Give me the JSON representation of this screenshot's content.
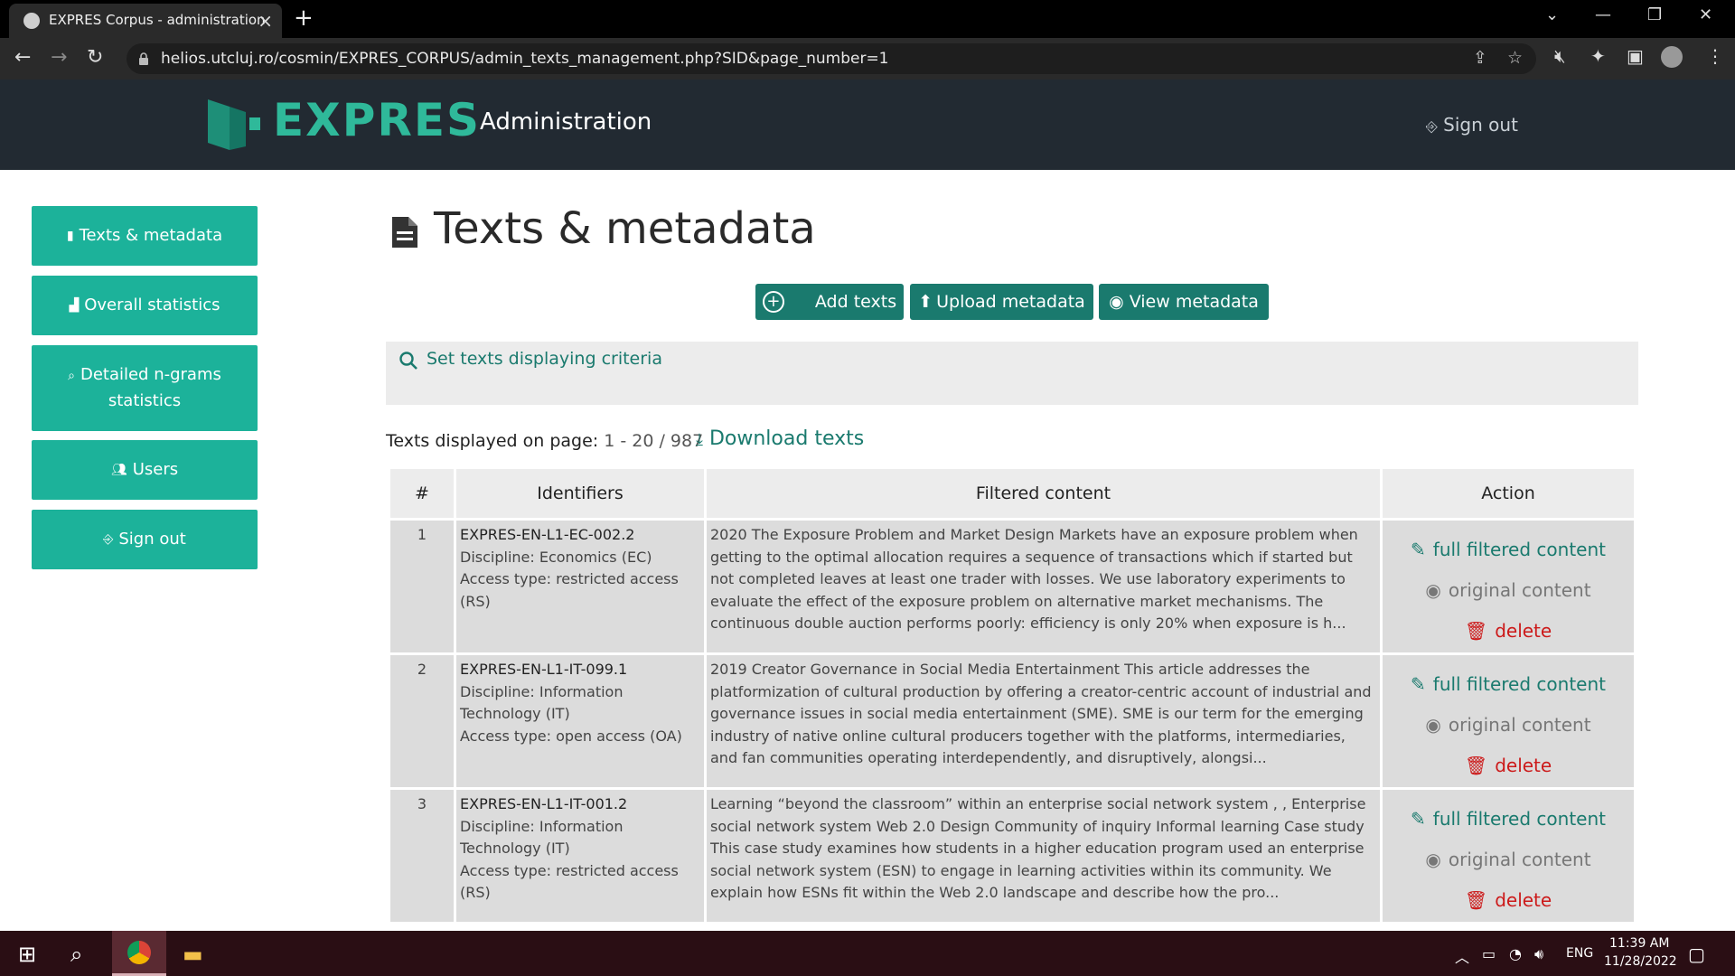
{
  "browser": {
    "tab_title": "EXPRES Corpus - administration",
    "tab_close": "×",
    "new_tab": "+",
    "url": "helios.utcluj.ro/cosmin/EXPRES_CORPUS/admin_texts_management.php?SID&page_number=1"
  },
  "header": {
    "logo": "EXPRES",
    "title": "Administration",
    "signout": "Sign out"
  },
  "sidebar": {
    "items": [
      {
        "label": "Texts & metadata",
        "icon": "file-icon"
      },
      {
        "label": "Overall statistics",
        "icon": "bar-chart-icon"
      },
      {
        "label": "Detailed n-grams statistics",
        "icon": "zoom-icon"
      },
      {
        "label": "Users",
        "icon": "users-icon"
      },
      {
        "label": "Sign out",
        "icon": "signout-icon"
      }
    ]
  },
  "main": {
    "title": "Texts & metadata",
    "buttons": {
      "add_texts": "Add texts",
      "upload_metadata": "Upload metadata",
      "view_metadata": "View metadata"
    },
    "criteria_label": "Set texts displaying criteria",
    "pagination_label": "Texts displayed on page:",
    "pagination_value": "1 - 20 / 987",
    "download": "Download texts"
  },
  "table": {
    "headers": [
      "#",
      "Identifiers",
      "Filtered content",
      "Action"
    ],
    "actions": {
      "edit": "full filtered content",
      "original": "original content",
      "delete": "delete"
    },
    "rows": [
      {
        "num": "1",
        "code": "EXPRES-EN-L1-EC-002.2",
        "discipline": "Discipline: Economics (EC)",
        "access": "Access type: restricted access (RS)",
        "content": "2020 The Exposure Problem and Market Design Markets have an exposure problem when getting to the optimal allocation requires a sequence of transactions which if started but not completed leaves at least one trader with losses. We use laboratory experiments to evaluate the effect of the exposure problem on alternative market mechanisms. The continuous double auction performs poorly: efficiency is only 20% when exposure is h..."
      },
      {
        "num": "2",
        "code": "EXPRES-EN-L1-IT-099.1",
        "discipline": "Discipline: Information Technology (IT)",
        "access": "Access type: open access (OA)",
        "content": "2019 Creator Governance in Social Media Entertainment This article addresses the platformization of cultural production by offering a creator-centric account of industrial and governance issues in social media entertainment (SME). SME is our term for the emerging industry of native online cultural producers together with the platforms, intermediaries, and fan communities operating interdependently, and disruptively, alongsi..."
      },
      {
        "num": "3",
        "code": "EXPRES-EN-L1-IT-001.2",
        "discipline": "Discipline: Information Technology (IT)",
        "access": "Access type: restricted access (RS)",
        "content": "Learning “beyond the classroom” within an enterprise social network system , , Enterprise social network system Web 2.0 Design Community of inquiry Informal learning Case study This case study examines how students in a higher education program used an enterprise social network system (ESN) to engage in learning activities within its community. We explain how ESNs fit within the Web 2.0 landscape and describe how the pro..."
      }
    ]
  },
  "taskbar": {
    "lang": "ENG",
    "time": "11:39 AM",
    "date": "11/28/2022"
  }
}
